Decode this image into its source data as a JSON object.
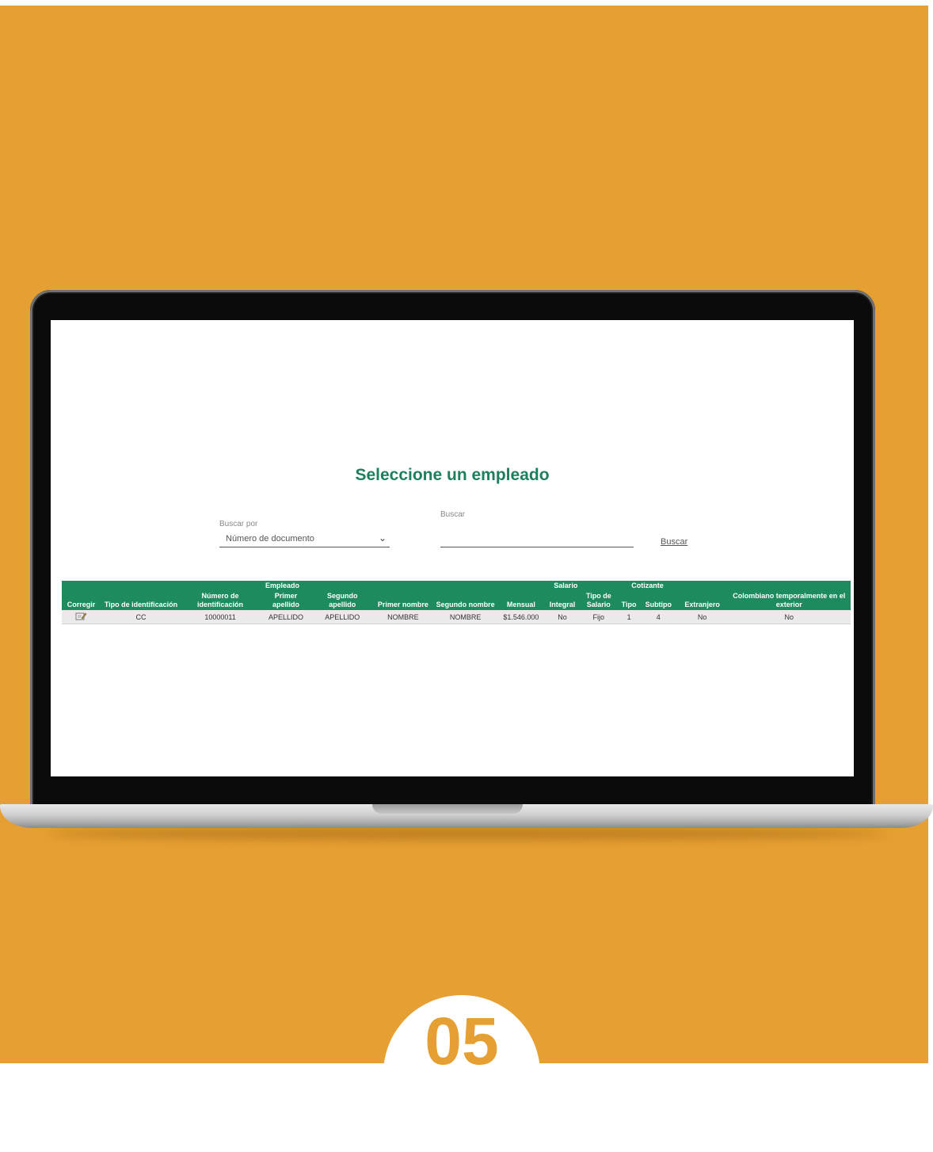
{
  "colors": {
    "background": "#E69F32",
    "accent": "#1E8B5E",
    "title": "#1E7F5C"
  },
  "page": {
    "title": "Seleccione un empleado"
  },
  "search": {
    "search_by_label": "Buscar por",
    "search_by_value": "Número de documento",
    "search_label": "Buscar",
    "search_value": "",
    "search_button": "Buscar"
  },
  "table": {
    "group_headers": {
      "empleado": "Empleado",
      "salario": "Salario",
      "cotizante": "Cotizante"
    },
    "columns": [
      "Corregir",
      "Tipo de identificación",
      "Número de identificación",
      "Primer apellido",
      "Segundo apellido",
      "Primer nombre",
      "Segundo nombre",
      "Mensual",
      "Integral",
      "Tipo de Salario",
      "Tipo",
      "Subtipo",
      "Extranjero",
      "Colombiano temporalmente en el exterior"
    ],
    "rows": [
      {
        "edit_icon": "edit-icon",
        "tipo_id": "CC",
        "numero_id": "10000011",
        "primer_apellido": "APELLIDO",
        "segundo_apellido": "APELLIDO",
        "primer_nombre": "NOMBRE",
        "segundo_nombre": "NOMBRE",
        "mensual": "$1.546.000",
        "integral": "No",
        "tipo_salario": "Fijo",
        "tipo": "1",
        "subtipo": "4",
        "extranjero": "No",
        "colombiano_exterior": "No"
      }
    ]
  },
  "badge": {
    "number": "05"
  }
}
